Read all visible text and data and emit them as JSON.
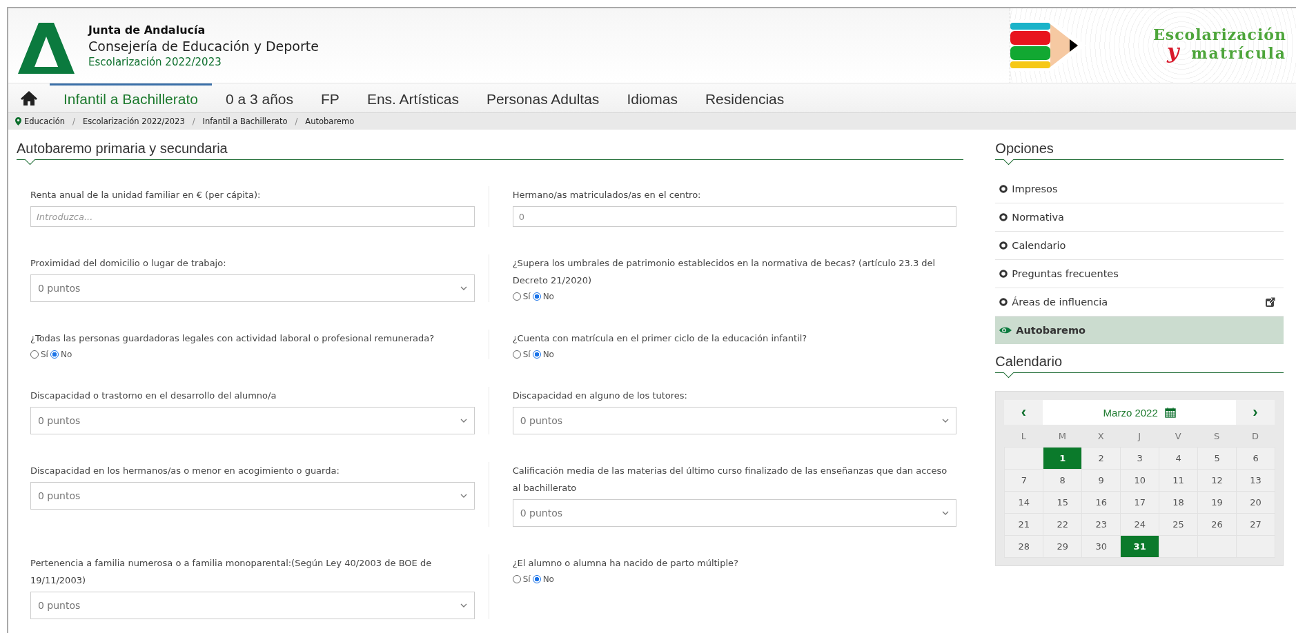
{
  "header": {
    "org": "Junta de Andalucía",
    "department": "Consejería de Educación y Deporte",
    "subtitle": "Escolarización 2022/2023",
    "banner_title": "Escolarización",
    "banner_y": "y",
    "banner_subtitle": "matrícula"
  },
  "nav": [
    {
      "label": "Infantil a Bachillerato",
      "selected": true
    },
    {
      "label": "0 a 3 años",
      "selected": false
    },
    {
      "label": "FP",
      "selected": false
    },
    {
      "label": "Ens. Artísticas",
      "selected": false
    },
    {
      "label": "Personas Adultas",
      "selected": false
    },
    {
      "label": "Idiomas",
      "selected": false
    },
    {
      "label": "Residencias",
      "selected": false
    }
  ],
  "breadcrumb": [
    {
      "kind": "link",
      "label": "Educación"
    },
    {
      "kind": "separator",
      "label": "/"
    },
    {
      "kind": "link",
      "label": "Escolarización 2022/2023"
    },
    {
      "kind": "separator",
      "label": "/"
    },
    {
      "kind": "link",
      "label": "Infantil a Bachillerato"
    },
    {
      "kind": "separator",
      "label": "/"
    },
    {
      "kind": "link",
      "label": "Autobaremo"
    }
  ],
  "form": {
    "title": "Autobaremo primaria y secundaria",
    "rows": [
      [
        {
          "kind": "input",
          "label": "Renta anual de la unidad familiar en € (per cápita):",
          "placeholder": "Introduzca..."
        },
        {
          "kind": "input",
          "label": "Hermano/as matriculados/as en el centro:",
          "value": "0"
        }
      ],
      [
        {
          "kind": "select",
          "label": "Proximidad del domicilio o lugar de trabajo:",
          "value": "0 puntos"
        },
        {
          "kind": "radio",
          "label": "¿Supera los umbrales de patrimonio establecidos en la normativa de becas? (artículo 23.3 del Decreto 21/2020)",
          "options": [
            {
              "label": "Sí",
              "selected": false
            },
            {
              "label": "No",
              "selected": true
            }
          ]
        }
      ],
      [
        {
          "kind": "radio",
          "label": "¿Todas las personas guardadoras legales con actividad laboral o profesional remunerada?",
          "options": [
            {
              "label": "Sí",
              "selected": false
            },
            {
              "label": "No",
              "selected": true
            }
          ]
        },
        {
          "kind": "radio",
          "label": "¿Cuenta con matrícula en el primer ciclo de la educación infantil?",
          "options": [
            {
              "label": "Sí",
              "selected": false
            },
            {
              "label": "No",
              "selected": true
            }
          ]
        }
      ],
      [
        {
          "kind": "select",
          "label": "Discapacidad o trastorno en el desarrollo del alumno/a",
          "value": "0 puntos"
        },
        {
          "kind": "select",
          "label": "Discapacidad en alguno de los tutores:",
          "value": "0 puntos"
        }
      ],
      [
        {
          "kind": "select",
          "label": "Discapacidad en los hermanos/as o menor en acogimiento o guarda:",
          "value": "0 puntos"
        },
        {
          "kind": "select",
          "label": "Calificación media de las materias del último curso finalizado de las enseñanzas que dan acceso al bachillerato",
          "value": "0 puntos"
        }
      ],
      [
        {
          "kind": "select",
          "label": "Pertenencia a familia numerosa o a familia monoparental:(Según Ley 40/2003 de BOE de 19/11/2003)",
          "value": "0 puntos"
        },
        {
          "kind": "radio",
          "label": "¿El alumno o alumna ha nacido de parto múltiple?",
          "options": [
            {
              "label": "Sí",
              "selected": false
            },
            {
              "label": "No",
              "selected": true
            }
          ]
        }
      ]
    ]
  },
  "sidebar": {
    "title": "Opciones",
    "items": [
      {
        "label": "Impresos",
        "selected": false,
        "external": false
      },
      {
        "label": "Normativa",
        "selected": false,
        "external": false
      },
      {
        "label": "Calendario",
        "selected": false,
        "external": false
      },
      {
        "label": "Preguntas frecuentes",
        "selected": false,
        "external": false
      },
      {
        "label": "Áreas de influencia",
        "selected": false,
        "external": true
      },
      {
        "label": "Autobaremo",
        "selected": true,
        "external": false
      }
    ]
  },
  "calendar": {
    "title": "Calendario",
    "prev": "‹",
    "next": "›",
    "month": "Marzo 2022",
    "weekdays": [
      "L",
      "M",
      "X",
      "J",
      "V",
      "S",
      "D"
    ],
    "weeks": [
      [
        {
          "kind": "blank"
        },
        {
          "kind": "day",
          "label": "1",
          "selected": true
        },
        {
          "kind": "day",
          "label": "2",
          "selected": false
        },
        {
          "kind": "day",
          "label": "3",
          "selected": false
        },
        {
          "kind": "day",
          "label": "4",
          "selected": false
        },
        {
          "kind": "day",
          "label": "5",
          "selected": false
        },
        {
          "kind": "day",
          "label": "6",
          "selected": false
        }
      ],
      [
        {
          "kind": "day",
          "label": "7",
          "selected": false
        },
        {
          "kind": "day",
          "label": "8",
          "selected": false
        },
        {
          "kind": "day",
          "label": "9",
          "selected": false
        },
        {
          "kind": "day",
          "label": "10",
          "selected": false
        },
        {
          "kind": "day",
          "label": "11",
          "selected": false
        },
        {
          "kind": "day",
          "label": "12",
          "selected": false
        },
        {
          "kind": "day",
          "label": "13",
          "selected": false
        }
      ],
      [
        {
          "kind": "day",
          "label": "14",
          "selected": false
        },
        {
          "kind": "day",
          "label": "15",
          "selected": false
        },
        {
          "kind": "day",
          "label": "16",
          "selected": false
        },
        {
          "kind": "day",
          "label": "17",
          "selected": false
        },
        {
          "kind": "day",
          "label": "18",
          "selected": false
        },
        {
          "kind": "day",
          "label": "19",
          "selected": false
        },
        {
          "kind": "day",
          "label": "20",
          "selected": false
        }
      ],
      [
        {
          "kind": "day",
          "label": "21",
          "selected": false
        },
        {
          "kind": "day",
          "label": "22",
          "selected": false
        },
        {
          "kind": "day",
          "label": "23",
          "selected": false
        },
        {
          "kind": "day",
          "label": "24",
          "selected": false
        },
        {
          "kind": "day",
          "label": "25",
          "selected": false
        },
        {
          "kind": "day",
          "label": "26",
          "selected": false
        },
        {
          "kind": "day",
          "label": "27",
          "selected": false
        }
      ],
      [
        {
          "kind": "day",
          "label": "28",
          "selected": false
        },
        {
          "kind": "day",
          "label": "29",
          "selected": false
        },
        {
          "kind": "day",
          "label": "30",
          "selected": false
        },
        {
          "kind": "day",
          "label": "31",
          "selected": true
        },
        {
          "kind": "blank"
        },
        {
          "kind": "blank"
        },
        {
          "kind": "blank"
        }
      ]
    ]
  }
}
